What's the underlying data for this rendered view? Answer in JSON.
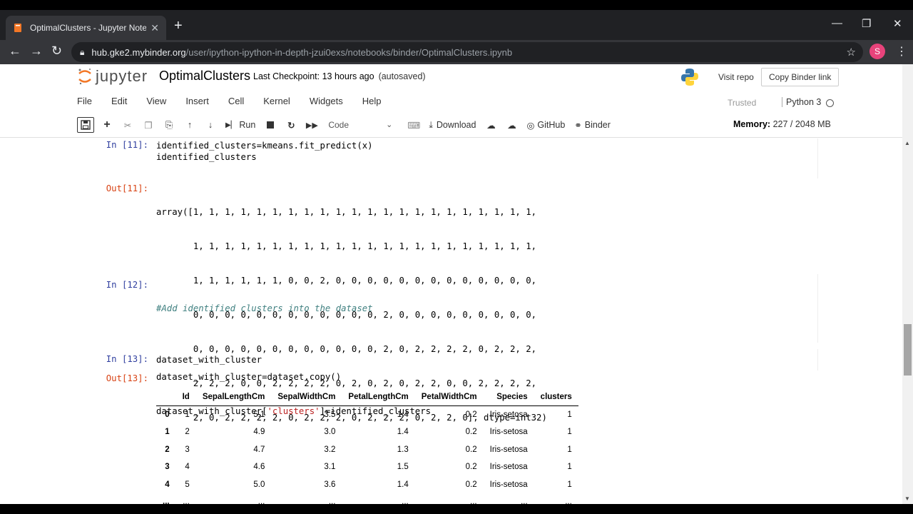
{
  "browser": {
    "tab_title": "OptimalClusters - Jupyter Notebook",
    "tab_close": "✕",
    "new_tab": "+",
    "url_host": "hub.gke2.mybinder.org",
    "url_path": "/user/ipython-ipython-in-depth-jzui0exs/notebooks/binder/OptimalClusters.ipynb",
    "avatar_letter": "S",
    "icons": [
      "back-icon",
      "forward-icon",
      "reload-icon",
      "lock-icon",
      "star-icon",
      "kebab-icon"
    ]
  },
  "header": {
    "logo_text": "jupyter",
    "notebook_name": "OptimalClusters",
    "checkpoint": "Last Checkpoint: 13 hours ago",
    "autosaved": "(autosaved)",
    "visit_repo": "Visit repo",
    "copy_binder_link": "Copy Binder link"
  },
  "menu": [
    "File",
    "Edit",
    "View",
    "Insert",
    "Cell",
    "Kernel",
    "Widgets",
    "Help"
  ],
  "kernel": {
    "trusted": "Trusted",
    "name": "Python 3"
  },
  "toolbar": {
    "run": "Run",
    "cell_type": "Code",
    "download": "Download",
    "github": "GitHub",
    "binder": "Binder",
    "memory_label": "Memory:",
    "memory_value": "227 / 2048 MB"
  },
  "cells": {
    "c11_in_prompt": "In [11]:",
    "c11_code_l1": "identified_clusters=kmeans.fit_predict(x)",
    "c11_code_l2": "identified_clusters",
    "c11_out_prompt": "Out[11]:",
    "c11_out": [
      "array([1, 1, 1, 1, 1, 1, 1, 1, 1, 1, 1, 1, 1, 1, 1, 1, 1, 1, 1, 1, 1, 1,",
      "       1, 1, 1, 1, 1, 1, 1, 1, 1, 1, 1, 1, 1, 1, 1, 1, 1, 1, 1, 1, 1, 1,",
      "       1, 1, 1, 1, 1, 1, 0, 0, 2, 0, 0, 0, 0, 0, 0, 0, 0, 0, 0, 0, 0, 0,",
      "       0, 0, 0, 0, 0, 0, 0, 0, 0, 0, 0, 0, 2, 0, 0, 0, 0, 0, 0, 0, 0, 0,",
      "       0, 0, 0, 0, 0, 0, 0, 0, 0, 0, 0, 0, 2, 0, 2, 2, 2, 2, 0, 2, 2, 2,",
      "       2, 2, 2, 0, 0, 2, 2, 2, 2, 0, 2, 0, 2, 0, 2, 2, 0, 0, 2, 2, 2, 2,",
      "       2, 0, 2, 2, 2, 2, 0, 2, 2, 2, 0, 2, 2, 2, 0, 2, 2, 0], dtype=int32)"
    ],
    "c12_in_prompt": "In [12]:",
    "c12_comment": "#Add identified clusters into the dataset",
    "c12_code_l1": "dataset_with_cluster=dataset.copy()",
    "c12_code_l2a": "dataset_with_cluster[",
    "c12_code_l2s": "'clusters'",
    "c12_code_l2b": "]=identified_clusters",
    "c13_in_prompt": "In [13]:",
    "c13_code": "dataset_with_cluster",
    "c13_out_prompt": "Out[13]:"
  },
  "dataframe": {
    "columns": [
      "",
      "Id",
      "SepalLengthCm",
      "SepalWidthCm",
      "PetalLengthCm",
      "PetalWidthCm",
      "Species",
      "clusters"
    ],
    "rows": [
      [
        "0",
        "1",
        "5.1",
        "3.5",
        "1.4",
        "0.2",
        "Iris-setosa",
        "1"
      ],
      [
        "1",
        "2",
        "4.9",
        "3.0",
        "1.4",
        "0.2",
        "Iris-setosa",
        "1"
      ],
      [
        "2",
        "3",
        "4.7",
        "3.2",
        "1.3",
        "0.2",
        "Iris-setosa",
        "1"
      ],
      [
        "3",
        "4",
        "4.6",
        "3.1",
        "1.5",
        "0.2",
        "Iris-setosa",
        "1"
      ],
      [
        "4",
        "5",
        "5.0",
        "3.6",
        "1.4",
        "0.2",
        "Iris-setosa",
        "1"
      ],
      [
        "...",
        "...",
        "...",
        "...",
        "...",
        "...",
        "...",
        "..."
      ]
    ]
  },
  "colors": {
    "in_prompt": "#303f9f",
    "out_prompt": "#d84315",
    "comment": "#408080",
    "string": "#ba2121",
    "jupyter_orange": "#f37726",
    "avatar": "#e8437b"
  }
}
